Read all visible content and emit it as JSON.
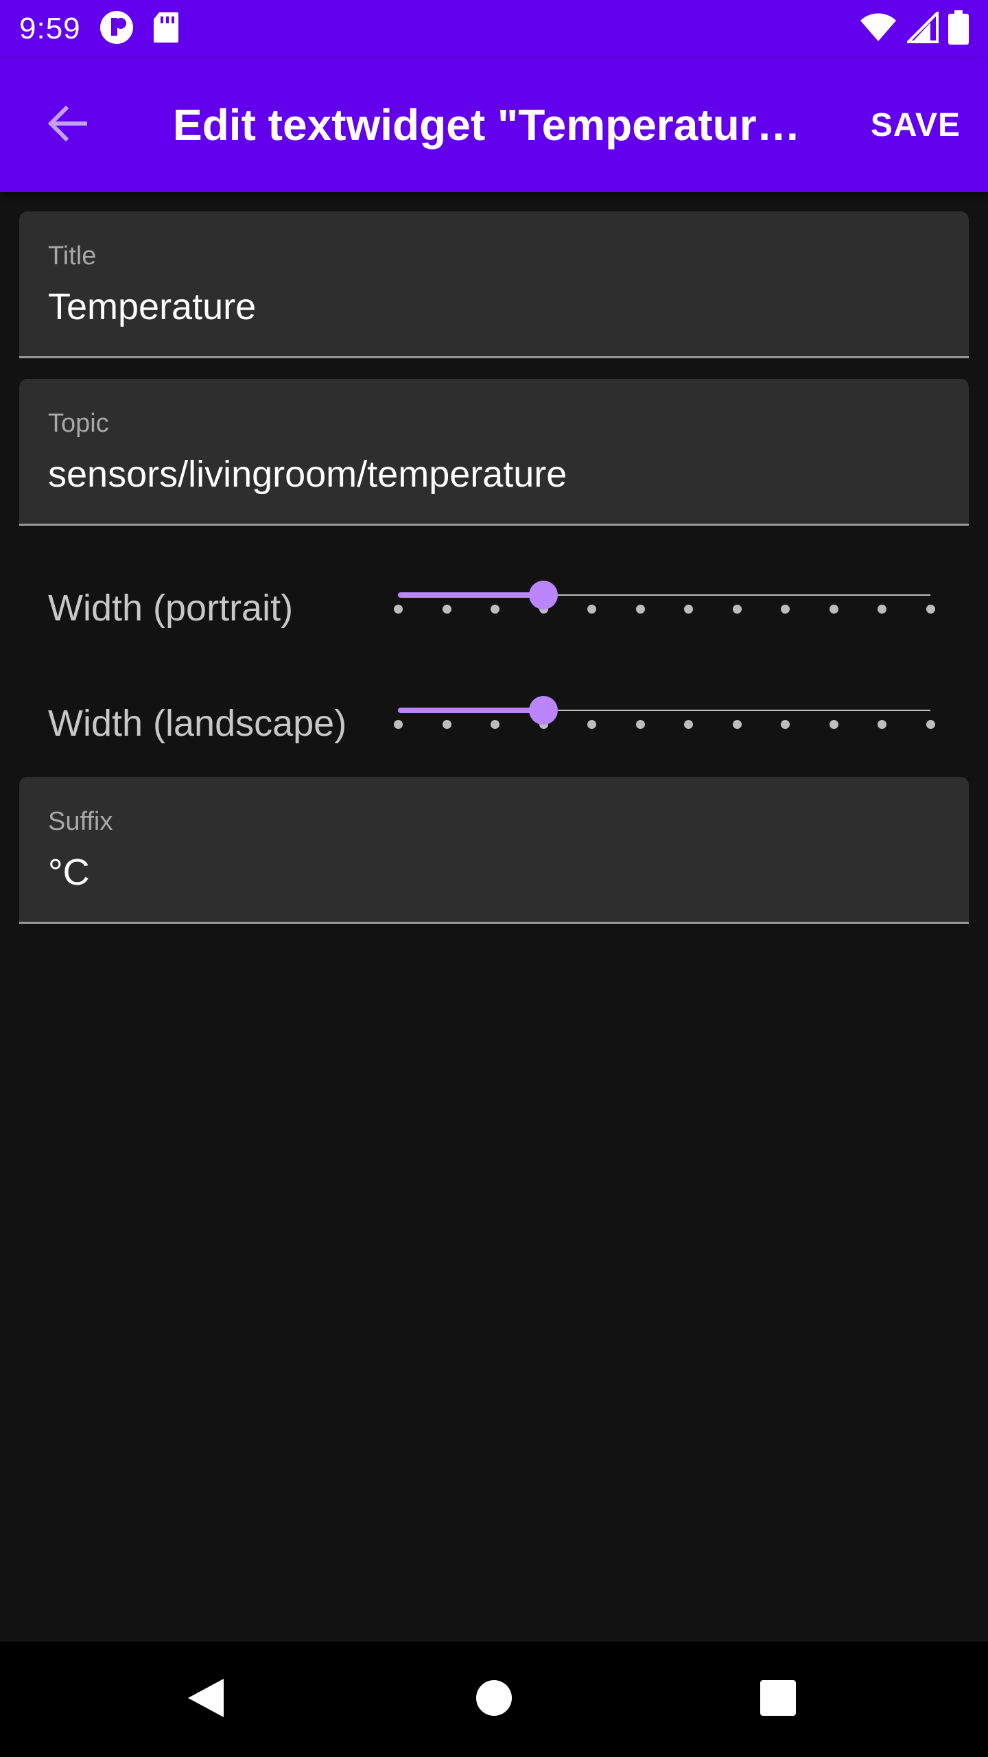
{
  "status_bar": {
    "time": "9:59",
    "icons": [
      "app-notification-icon",
      "sd-card-icon",
      "wifi-icon",
      "cell-signal-icon",
      "battery-icon"
    ]
  },
  "app_bar": {
    "title": "Edit textwidget \"Temperatur…",
    "save_label": "SAVE",
    "back_icon": "arrow-back-icon"
  },
  "form": {
    "title_field": {
      "label": "Title",
      "value": "Temperature"
    },
    "topic_field": {
      "label": "Topic",
      "value": "sensors/livingroom/temperature"
    },
    "width_portrait": {
      "label": "Width (portrait)",
      "value": 3,
      "min": 0,
      "max": 11
    },
    "width_landscape": {
      "label": "Width (landscape)",
      "value": 3,
      "min": 0,
      "max": 11
    },
    "suffix_field": {
      "label": "Suffix",
      "value": "°C"
    }
  },
  "nav_bar": {
    "icons": [
      "nav-back-icon",
      "nav-home-icon",
      "nav-recents-icon"
    ]
  },
  "colors": {
    "primary": "#6200ee",
    "accent": "#bb86fc",
    "background": "#121212",
    "field_background": "#2e2e2e"
  }
}
